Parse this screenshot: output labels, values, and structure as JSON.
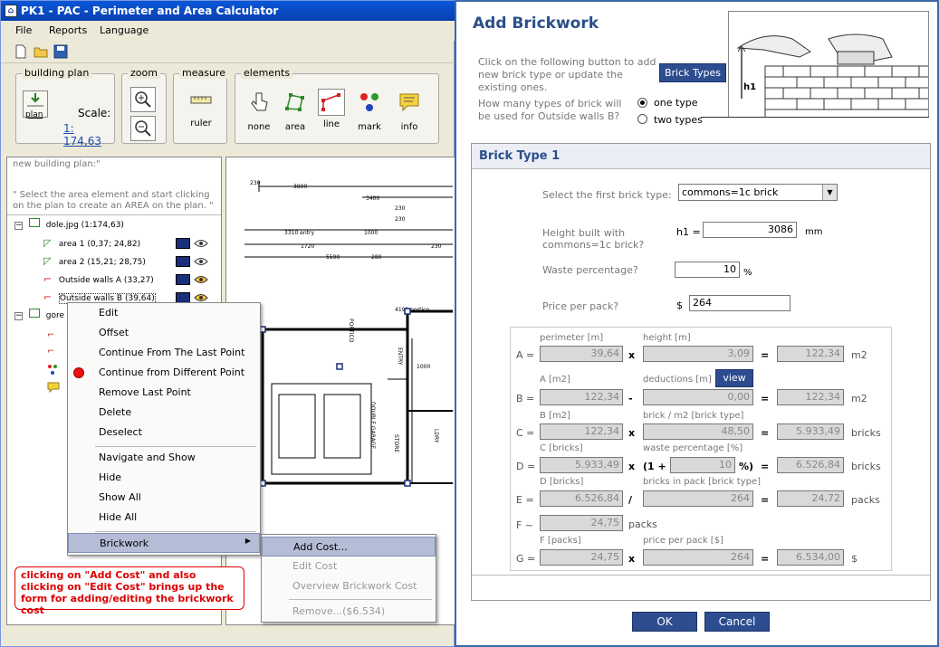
{
  "app": {
    "title": "PK1 - PAC - Perimeter and Area Calculator",
    "menu": [
      "File",
      "Reports",
      "Language"
    ]
  },
  "ribbon": {
    "building_plan": {
      "title": "building plan",
      "button": "plan",
      "scale_label": "Scale:",
      "scale_value": "1: 174,63"
    },
    "zoom": {
      "title": "zoom"
    },
    "measure": {
      "title": "measure",
      "ruler": "ruler"
    },
    "elements": {
      "title": "elements",
      "none": "none",
      "area": "area",
      "line": "line",
      "mark": "mark",
      "info": "info"
    }
  },
  "left_panel": {
    "hint1": "new building plan:\"",
    "hint2": "\" Select the area element and start clicking on the plan to create an AREA on the plan. \"",
    "tree": {
      "root": "dole.jpg (1:174,63)",
      "items": [
        "area 1 (0,37; 24,82)",
        "area 2 (15,21; 28,75)",
        "Outside walls A (33,27)",
        "Outside walls B (39,64)"
      ],
      "root2": "gore"
    }
  },
  "context_menu": {
    "items": [
      "Edit",
      "Offset",
      "Continue From The Last Point",
      "Continue from Different Point",
      "Remove Last Point",
      "Delete",
      "Deselect",
      "Navigate and Show",
      "Hide",
      "Show All",
      "Hide All",
      "Brickwork"
    ],
    "submenu": [
      "Add Cost...",
      "Edit Cost",
      "Overview Brickwork Cost",
      "Remove...($6.534)"
    ]
  },
  "callout": "clicking on \"Add Cost\" and also clicking on \"Edit Cost\" brings up the form for adding/editing the brickwork cost",
  "plan": {
    "dims": [
      "3800",
      "3400",
      "4190 portico",
      "5010 garage internal",
      "3310 entry",
      "1720",
      "1000",
      "1000",
      "5590",
      "280",
      "230",
      "230",
      "230",
      "230"
    ],
    "labels": [
      "DOUBLE GARAGE",
      "STORE",
      "ENTRY",
      "PORTICO",
      "LDRY"
    ]
  },
  "dialog": {
    "title": "Add Brickwork",
    "intro": "Click on the following button to add new brick type or update the existing ones.",
    "brick_types_button": "Brick Types",
    "question": "How many types of brick will be used for Outside walls B?",
    "radio_one": "one type",
    "radio_two": "two types",
    "image_label": "h1",
    "section_title": "Brick Type 1",
    "select_label": "Select the first brick type:",
    "select_value": "commons=1c brick",
    "height_label": "Height built with commons=1c brick?",
    "h1_label": "h1 =",
    "h1_value": "3086",
    "h1_unit": "mm",
    "waste_label": "Waste percentage?",
    "waste_value": "10",
    "waste_unit": "%",
    "price_label": "Price per pack?",
    "price_currency": "$",
    "price_value": "264",
    "calc": {
      "A": {
        "lbl1": "perimeter [m]",
        "v1": "39,64",
        "op": "x",
        "lbl2": "height [m]",
        "v2": "3,09",
        "res": "122,34",
        "unit": "m2"
      },
      "B": {
        "lbl1": "A [m2]",
        "v1": "122,34",
        "op": "-",
        "lbl2": "deductions [m]",
        "v2": "0,00",
        "res": "122,34",
        "unit": "m2",
        "view": "view"
      },
      "C": {
        "lbl1": "B [m2]",
        "v1": "122,34",
        "op": "x",
        "lbl2": "brick / m2 [brick type]",
        "v2": "48,50",
        "res": "5.933,49",
        "unit": "bricks"
      },
      "D": {
        "lbl1": "C [bricks]",
        "v1": "5.933,49",
        "op": "x",
        "lbl2": "waste percentage [%]",
        "pre": "(1 +",
        "v2": "10",
        "post": "%)",
        "res": "6.526,84",
        "unit": "bricks"
      },
      "E": {
        "lbl1": "D [bricks]",
        "v1": "6.526,84",
        "op": "/",
        "lbl2": "bricks in pack [brick type]",
        "v2": "264",
        "res": "24,72",
        "unit": "packs"
      },
      "F": {
        "v1": "24,75",
        "unit": "packs"
      },
      "G": {
        "lbl1": "F [packs]",
        "v1": "24,75",
        "op": "x",
        "lbl2": "price per pack [$]",
        "v2": "264",
        "res": "6.534,00",
        "unit": "$"
      }
    },
    "row_labels": {
      "A": "A =",
      "B": "B =",
      "C": "C =",
      "D": "D =",
      "E": "E =",
      "F": "F ~",
      "G": "G ="
    },
    "ok": "OK",
    "cancel": "Cancel"
  }
}
